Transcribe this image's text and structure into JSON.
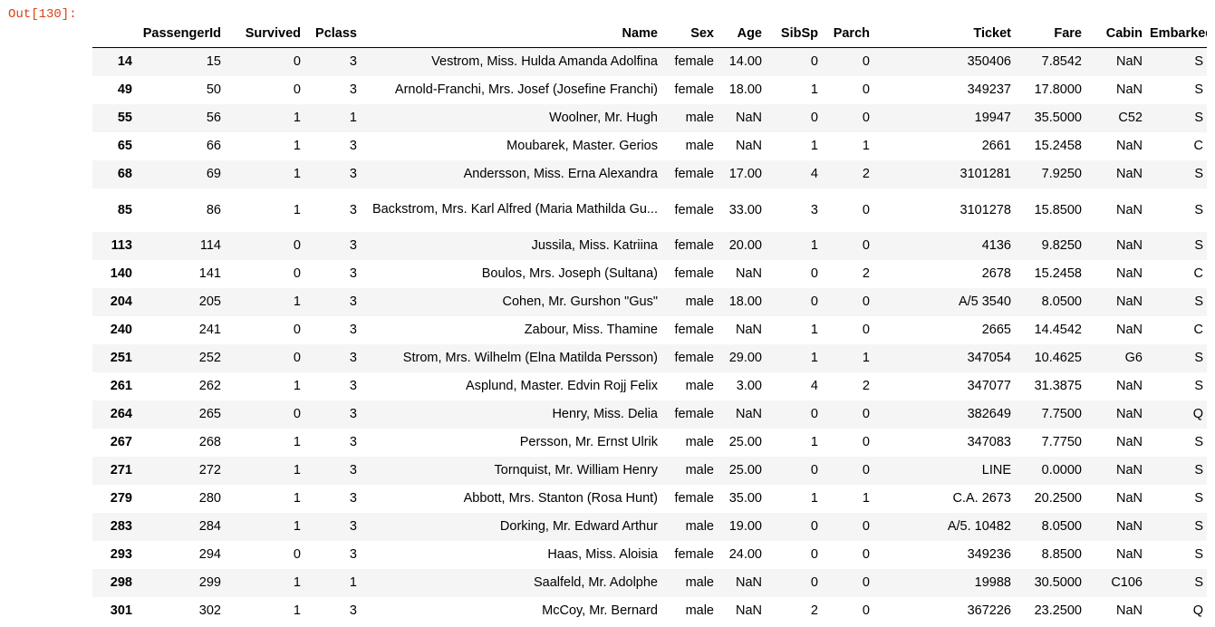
{
  "prompt": "Out[130]:",
  "table": {
    "columns": [
      "",
      "PassengerId",
      "Survived",
      "Pclass",
      "Name",
      "Sex",
      "Age",
      "SibSp",
      "Parch",
      "Ticket",
      "Fare",
      "Cabin",
      "Embarked"
    ],
    "rows": [
      [
        "14",
        "15",
        "0",
        "3",
        "Vestrom, Miss. Hulda Amanda Adolfina",
        "female",
        "14.00",
        "0",
        "0",
        "350406",
        "7.8542",
        "NaN",
        "S"
      ],
      [
        "49",
        "50",
        "0",
        "3",
        "Arnold-Franchi, Mrs. Josef (Josefine Franchi)",
        "female",
        "18.00",
        "1",
        "0",
        "349237",
        "17.8000",
        "NaN",
        "S"
      ],
      [
        "55",
        "56",
        "1",
        "1",
        "Woolner, Mr. Hugh",
        "male",
        "NaN",
        "0",
        "0",
        "19947",
        "35.5000",
        "C52",
        "S"
      ],
      [
        "65",
        "66",
        "1",
        "3",
        "Moubarek, Master. Gerios",
        "male",
        "NaN",
        "1",
        "1",
        "2661",
        "15.2458",
        "NaN",
        "C"
      ],
      [
        "68",
        "69",
        "1",
        "3",
        "Andersson, Miss. Erna Alexandra",
        "female",
        "17.00",
        "4",
        "2",
        "3101281",
        "7.9250",
        "NaN",
        "S"
      ],
      [
        "85",
        "86",
        "1",
        "3",
        "Backstrom, Mrs. Karl Alfred (Maria Mathilda Gu...",
        "female",
        "33.00",
        "3",
        "0",
        "3101278",
        "15.8500",
        "NaN",
        "S"
      ],
      [
        "113",
        "114",
        "0",
        "3",
        "Jussila, Miss. Katriina",
        "female",
        "20.00",
        "1",
        "0",
        "4136",
        "9.8250",
        "NaN",
        "S"
      ],
      [
        "140",
        "141",
        "0",
        "3",
        "Boulos, Mrs. Joseph (Sultana)",
        "female",
        "NaN",
        "0",
        "2",
        "2678",
        "15.2458",
        "NaN",
        "C"
      ],
      [
        "204",
        "205",
        "1",
        "3",
        "Cohen, Mr. Gurshon \"Gus\"",
        "male",
        "18.00",
        "0",
        "0",
        "A/5 3540",
        "8.0500",
        "NaN",
        "S"
      ],
      [
        "240",
        "241",
        "0",
        "3",
        "Zabour, Miss. Thamine",
        "female",
        "NaN",
        "1",
        "0",
        "2665",
        "14.4542",
        "NaN",
        "C"
      ],
      [
        "251",
        "252",
        "0",
        "3",
        "Strom, Mrs. Wilhelm (Elna Matilda Persson)",
        "female",
        "29.00",
        "1",
        "1",
        "347054",
        "10.4625",
        "G6",
        "S"
      ],
      [
        "261",
        "262",
        "1",
        "3",
        "Asplund, Master. Edvin Rojj Felix",
        "male",
        "3.00",
        "4",
        "2",
        "347077",
        "31.3875",
        "NaN",
        "S"
      ],
      [
        "264",
        "265",
        "0",
        "3",
        "Henry, Miss. Delia",
        "female",
        "NaN",
        "0",
        "0",
        "382649",
        "7.7500",
        "NaN",
        "Q"
      ],
      [
        "267",
        "268",
        "1",
        "3",
        "Persson, Mr. Ernst Ulrik",
        "male",
        "25.00",
        "1",
        "0",
        "347083",
        "7.7750",
        "NaN",
        "S"
      ],
      [
        "271",
        "272",
        "1",
        "3",
        "Tornquist, Mr. William Henry",
        "male",
        "25.00",
        "0",
        "0",
        "LINE",
        "0.0000",
        "NaN",
        "S"
      ],
      [
        "279",
        "280",
        "1",
        "3",
        "Abbott, Mrs. Stanton (Rosa Hunt)",
        "female",
        "35.00",
        "1",
        "1",
        "C.A. 2673",
        "20.2500",
        "NaN",
        "S"
      ],
      [
        "283",
        "284",
        "1",
        "3",
        "Dorking, Mr. Edward Arthur",
        "male",
        "19.00",
        "0",
        "0",
        "A/5. 10482",
        "8.0500",
        "NaN",
        "S"
      ],
      [
        "293",
        "294",
        "0",
        "3",
        "Haas, Miss. Aloisia",
        "female",
        "24.00",
        "0",
        "0",
        "349236",
        "8.8500",
        "NaN",
        "S"
      ],
      [
        "298",
        "299",
        "1",
        "1",
        "Saalfeld, Mr. Adolphe",
        "male",
        "NaN",
        "0",
        "0",
        "19988",
        "30.5000",
        "C106",
        "S"
      ],
      [
        "301",
        "302",
        "1",
        "3",
        "McCoy, Mr. Bernard",
        "male",
        "NaN",
        "2",
        "0",
        "367226",
        "23.2500",
        "NaN",
        "Q"
      ]
    ]
  }
}
